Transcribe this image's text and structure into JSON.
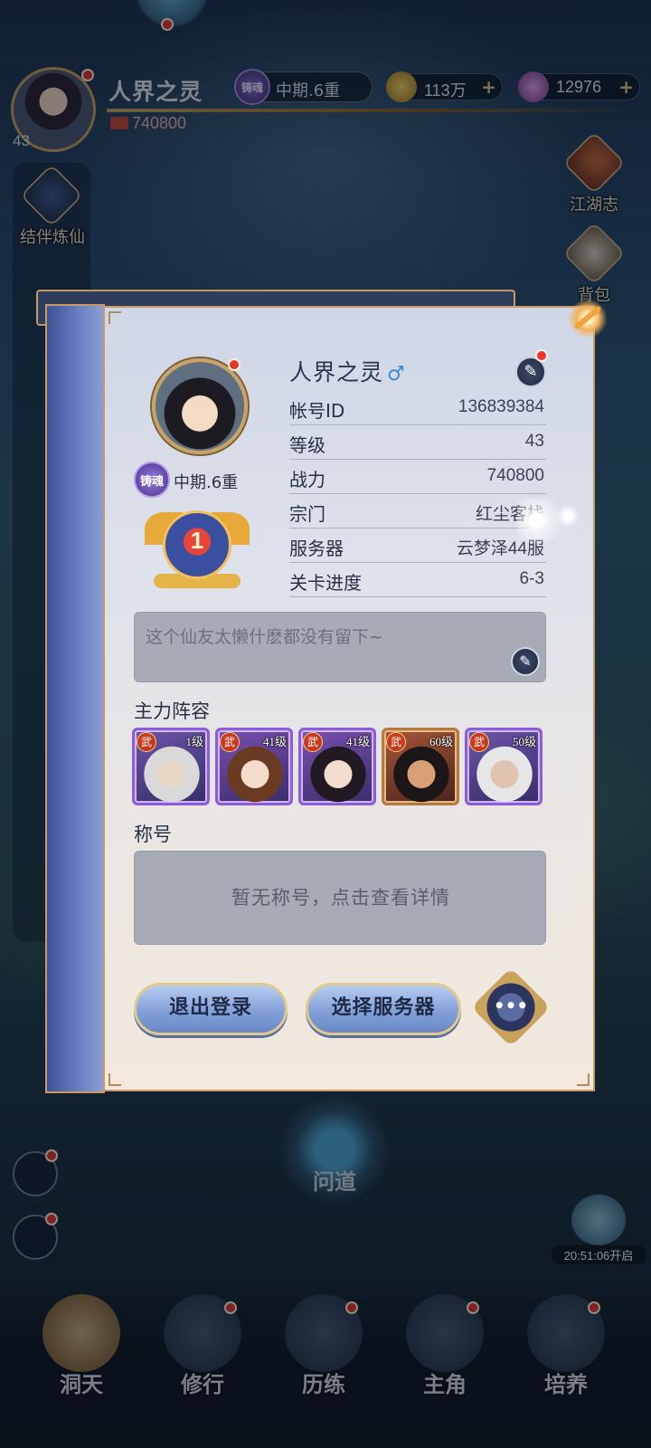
{
  "topbar": {
    "player_name": "人界之灵",
    "level": "43",
    "realm_badge": "铸魂",
    "realm": "中期.6重",
    "gold": "113万",
    "gems": "12976",
    "power": "740800"
  },
  "side_left": {
    "partner_label": "结伴炼仙"
  },
  "side_right": [
    {
      "label": "江湖志",
      "icon": "book-icon"
    },
    {
      "label": "背包",
      "icon": "bag-icon"
    }
  ],
  "profile": {
    "name": "人界之灵",
    "gender_symbol": "♂",
    "realm_badge": "铸魂",
    "realm": "中期.6重",
    "rank": "1",
    "info": [
      {
        "key": "帐号ID",
        "value": "136839384"
      },
      {
        "key": "等级",
        "value": "43"
      },
      {
        "key": "战力",
        "value": "740800"
      },
      {
        "key": "宗门",
        "value": "红尘客栈"
      },
      {
        "key": "服务器",
        "value": "云梦泽44服"
      },
      {
        "key": "关卡进度",
        "value": "6-3"
      }
    ],
    "signature": "这个仙友太懒什麽都没有留下~",
    "lineup_title": "主力阵容",
    "heroes": [
      {
        "type": "武",
        "level": "1级",
        "frame": "purple"
      },
      {
        "type": "武",
        "level": "41级",
        "frame": "purple"
      },
      {
        "type": "武",
        "level": "41级",
        "frame": "purple"
      },
      {
        "type": "武",
        "level": "60级",
        "frame": "orange"
      },
      {
        "type": "武",
        "level": "50级",
        "frame": "purple"
      }
    ],
    "title_section": "称号",
    "title_placeholder": "暂无称号，点击查看详情",
    "logout_label": "退出登录",
    "server_label": "选择服务器",
    "more_label": "•••"
  },
  "world": {
    "wendao_label": "问道",
    "timer_text": "20:51:06开启"
  },
  "bottom_nav": [
    {
      "label": "洞天",
      "icon": "cave-icon"
    },
    {
      "label": "修行",
      "icon": "cultivate-icon"
    },
    {
      "label": "历练",
      "icon": "train-icon"
    },
    {
      "label": "主角",
      "icon": "hero-icon"
    },
    {
      "label": "培养",
      "icon": "nurture-icon"
    }
  ],
  "colors": {
    "accent_gold": "#c79a68",
    "button_blue": "#7f9dd6",
    "badge_red": "#e8352d"
  }
}
